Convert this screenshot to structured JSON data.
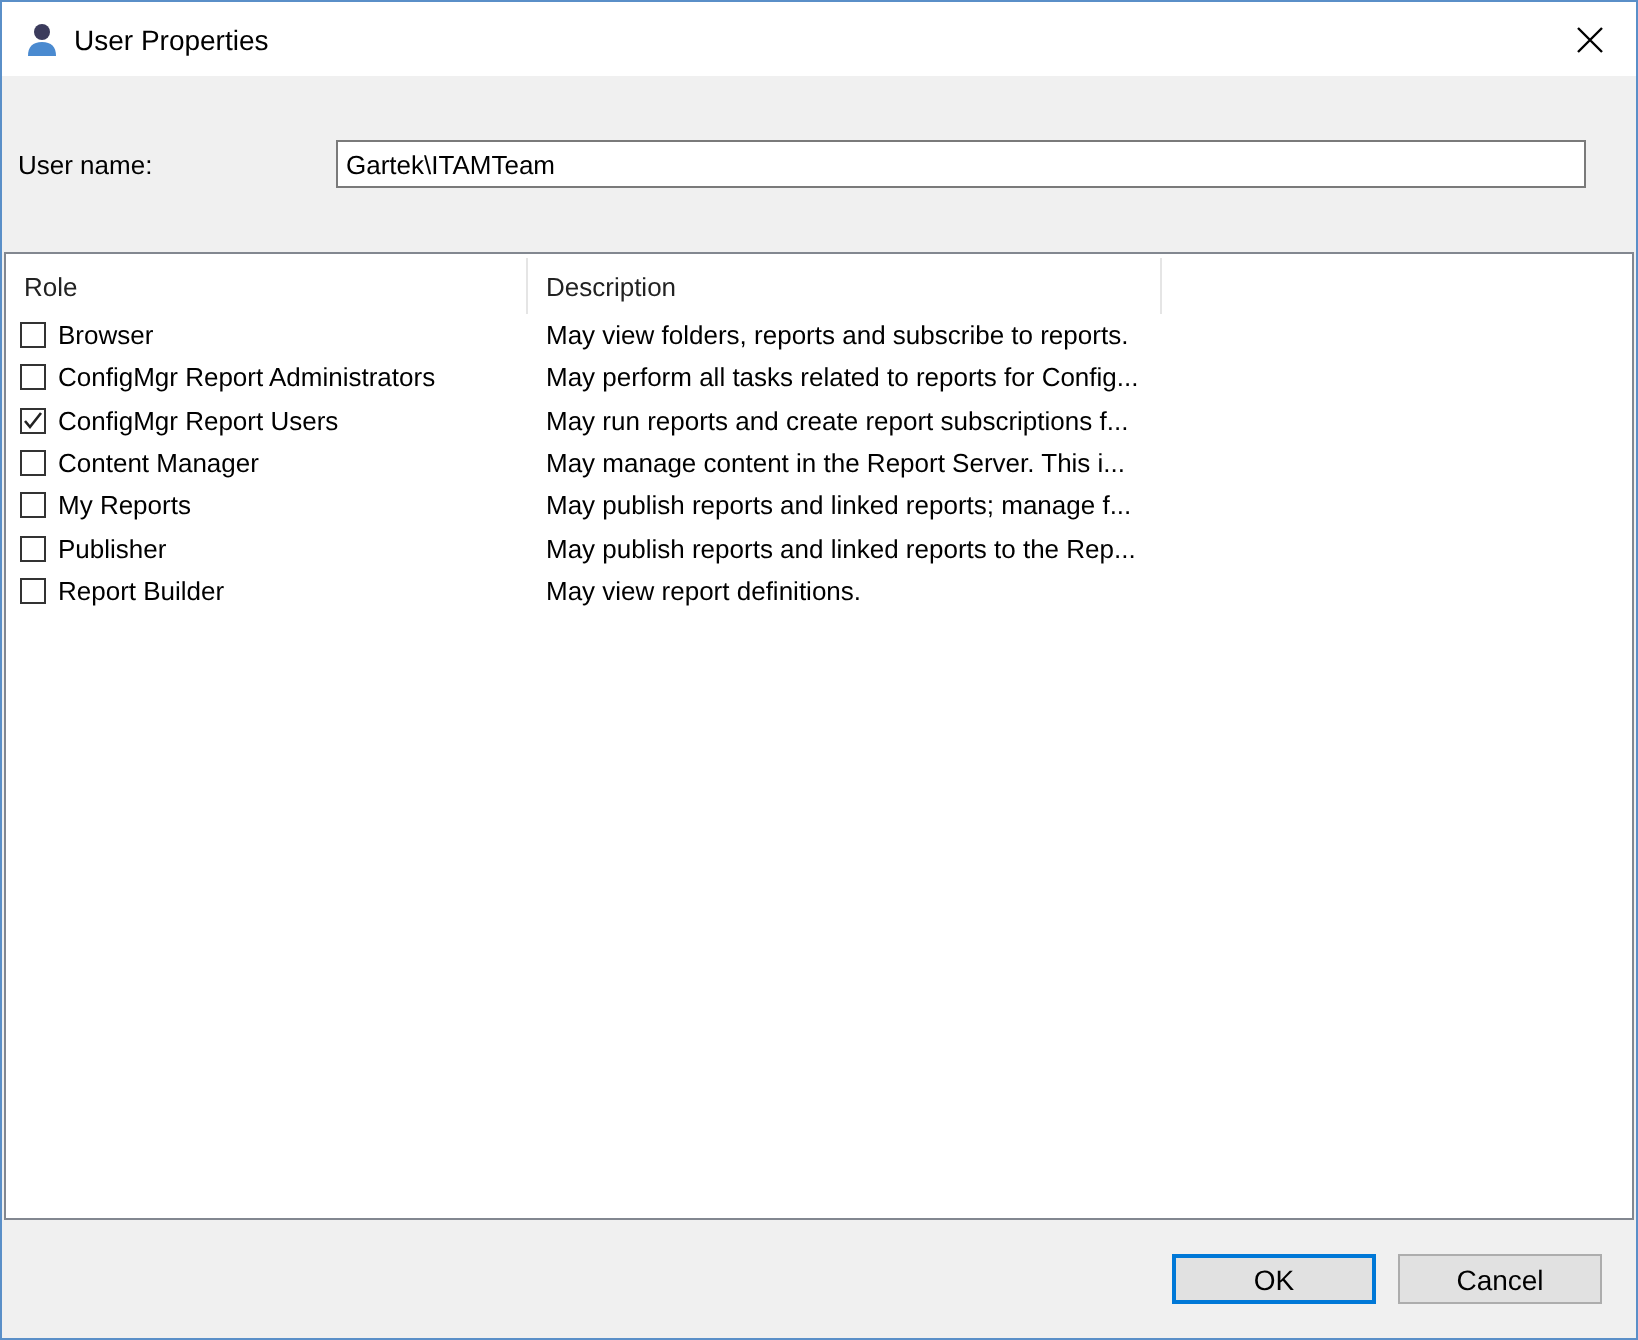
{
  "window": {
    "title": "User Properties"
  },
  "user_name": {
    "label": "User name:",
    "value": "Gartek\\ITAMTeam"
  },
  "table": {
    "columns": [
      "Role",
      "Description"
    ],
    "rows": [
      {
        "role": "Browser",
        "description": "May view folders, reports and subscribe to reports.",
        "checked": false
      },
      {
        "role": "ConfigMgr Report Administrators",
        "description": "May perform all tasks related to reports for Config...",
        "checked": false
      },
      {
        "role": "ConfigMgr Report Users",
        "description": "May run reports and create report subscriptions f...",
        "checked": true
      },
      {
        "role": "Content Manager",
        "description": "May manage content in the Report Server.  This i...",
        "checked": false
      },
      {
        "role": "My Reports",
        "description": "May publish reports and linked reports; manage f...",
        "checked": false
      },
      {
        "role": "Publisher",
        "description": "May publish reports and linked reports to the Rep...",
        "checked": false
      },
      {
        "role": "Report Builder",
        "description": "May view report definitions.",
        "checked": false
      }
    ]
  },
  "buttons": [
    {
      "label": "OK",
      "default": true
    },
    {
      "label": "Cancel",
      "default": false
    }
  ]
}
